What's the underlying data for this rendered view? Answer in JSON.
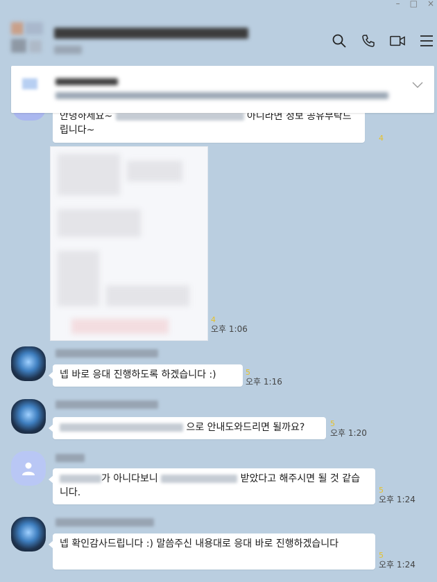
{
  "window": {
    "minimize": "–",
    "maximize": "□",
    "close": "×"
  },
  "header": {
    "icons": [
      "search-icon",
      "phone-icon",
      "video-icon",
      "menu-icon"
    ]
  },
  "messages": [
    {
      "text_before": "안녕하세요~",
      "text_after": "아니라면 정보 공유부탁드립니다~",
      "count": "4"
    },
    {
      "count": "4",
      "time": "오후 1:06"
    },
    {
      "text": "넵 바로 응대 진행하도록 하겠습니다 :)",
      "count": "5",
      "time": "오후 1:16"
    },
    {
      "text_after": "으로 안내도와드리면 될까요?",
      "count": "5",
      "time": "오후 1:20"
    },
    {
      "text_mid": "가 아니다보니",
      "text_after": "받았다고 해주시면 될 것 같습니다.",
      "count": "5",
      "time": "오후 1:24"
    },
    {
      "text": "넵 확인감사드립니다 :) 말씀주신 내용대로 응대 바로 진행하겠습니다",
      "count": "5",
      "time": "오후 1:24"
    }
  ],
  "colors": {
    "background": "#bacee0",
    "bubble": "#ffffff",
    "unread": "#e6c12a"
  }
}
